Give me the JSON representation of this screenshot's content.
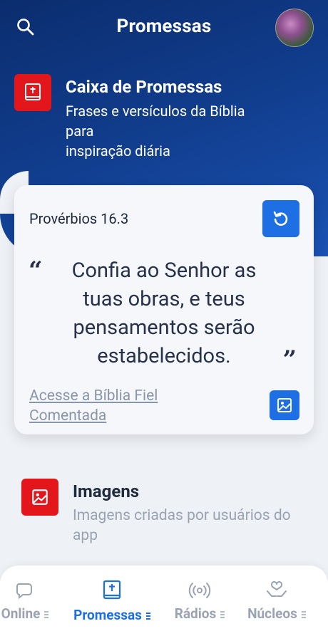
{
  "header": {
    "title": "Promessas"
  },
  "promise_box": {
    "title": "Caixa de Promessas",
    "subtitle_line1": "Frases e versículos da Bíblia",
    "subtitle_line2": "para",
    "subtitle_line3": "inspiração diária"
  },
  "verse_card": {
    "reference": "Provérbios 16.3",
    "quote_open": "“",
    "text": "Confia ao Senhor as tuas obras, e teus pensamentos serão estabelecidos.",
    "quote_close": "”",
    "link_line1": "Acesse a Bíblia Fiel",
    "link_line2": "Comentada"
  },
  "images_section": {
    "title": "Imagens",
    "subtitle": "Imagens criadas por usuários do app"
  },
  "bottom_nav": {
    "items": [
      {
        "label": "Online",
        "icon": "chat-icon",
        "active": false
      },
      {
        "label": "Promessas",
        "icon": "bible-icon",
        "active": true
      },
      {
        "label": "Rádios",
        "icon": "radio-icon",
        "active": false
      },
      {
        "label": "Núcleos",
        "icon": "hands-heart-icon",
        "active": false
      }
    ]
  },
  "colors": {
    "header_blue": "#123f91",
    "accent_red": "#e3161c",
    "accent_blue": "#1e6fe3",
    "text_dark": "#27324a",
    "text_muted": "#9aa3b2"
  }
}
